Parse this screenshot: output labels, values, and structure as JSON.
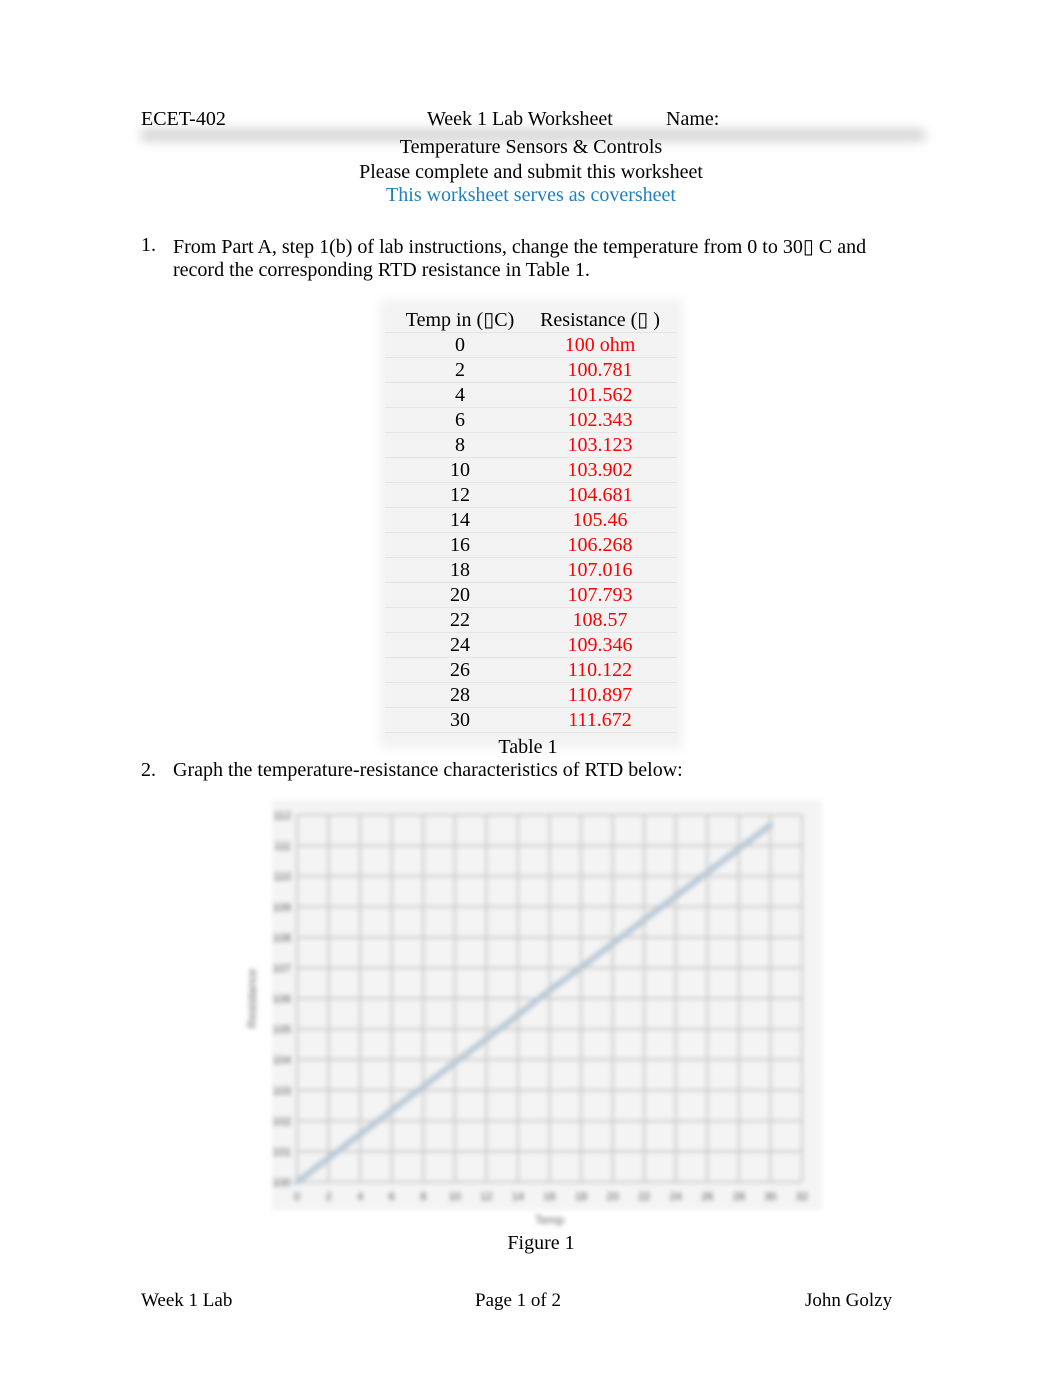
{
  "header": {
    "course": "ECET-402",
    "title": "Week 1 Lab Worksheet",
    "name_label": "Name:"
  },
  "subtitle": "Temperature Sensors & Controls",
  "instruction": "Please complete and submit this worksheet",
  "coversheet_note": "This worksheet serves as coversheet",
  "colors": {
    "note_blue": "#1f7fc0",
    "answer_red": "#ff0000",
    "line": "#b9c9d6"
  },
  "question1": {
    "number": "1.",
    "line1": "From Part A, step 1(b) of lab instructions, change the temperature from 0 to 30▯ C and",
    "line2": "record the corresponding RTD resistance in Table 1."
  },
  "table1": {
    "headers": [
      "Temp in (▯C)",
      "Resistance (▯ )"
    ],
    "rows": [
      [
        "0",
        "100 ohm"
      ],
      [
        "2",
        "100.781"
      ],
      [
        "4",
        "101.562"
      ],
      [
        "6",
        "102.343"
      ],
      [
        "8",
        "103.123"
      ],
      [
        "10",
        "103.902"
      ],
      [
        "12",
        "104.681"
      ],
      [
        "14",
        "105.46"
      ],
      [
        "16",
        "106.268"
      ],
      [
        "18",
        "107.016"
      ],
      [
        "20",
        "107.793"
      ],
      [
        "22",
        "108.57"
      ],
      [
        "24",
        "109.346"
      ],
      [
        "26",
        "110.122"
      ],
      [
        "28",
        "110.897"
      ],
      [
        "30",
        "111.672"
      ]
    ],
    "caption": "Table 1"
  },
  "question2": {
    "number": "2.",
    "text": "Graph the temperature-resistance characteristics of RTD below:"
  },
  "figure_caption": "Figure 1",
  "chart_data": {
    "type": "line",
    "title": "",
    "xlabel": "Temp",
    "ylabel": "Resistance",
    "x": [
      0,
      2,
      4,
      6,
      8,
      10,
      12,
      14,
      16,
      18,
      20,
      22,
      24,
      26,
      28,
      30
    ],
    "series": [
      {
        "name": "Resistance",
        "values": [
          100,
          100.781,
          101.562,
          102.343,
          103.123,
          103.902,
          104.681,
          105.46,
          106.268,
          107.016,
          107.793,
          108.57,
          109.346,
          110.122,
          110.897,
          111.672
        ]
      }
    ],
    "xlim": [
      0,
      32
    ],
    "ylim": [
      100,
      112
    ],
    "xticks": [
      0,
      2,
      4,
      6,
      8,
      10,
      12,
      14,
      16,
      18,
      20,
      22,
      24,
      26,
      28,
      30,
      32
    ],
    "yticks": [
      100,
      101,
      102,
      103,
      104,
      105,
      106,
      107,
      108,
      109,
      110,
      111,
      112
    ],
    "grid": true,
    "legend": "none"
  },
  "footer": {
    "left": "Week 1 Lab",
    "center": "Page 1 of 2",
    "right": "John Golzy"
  }
}
